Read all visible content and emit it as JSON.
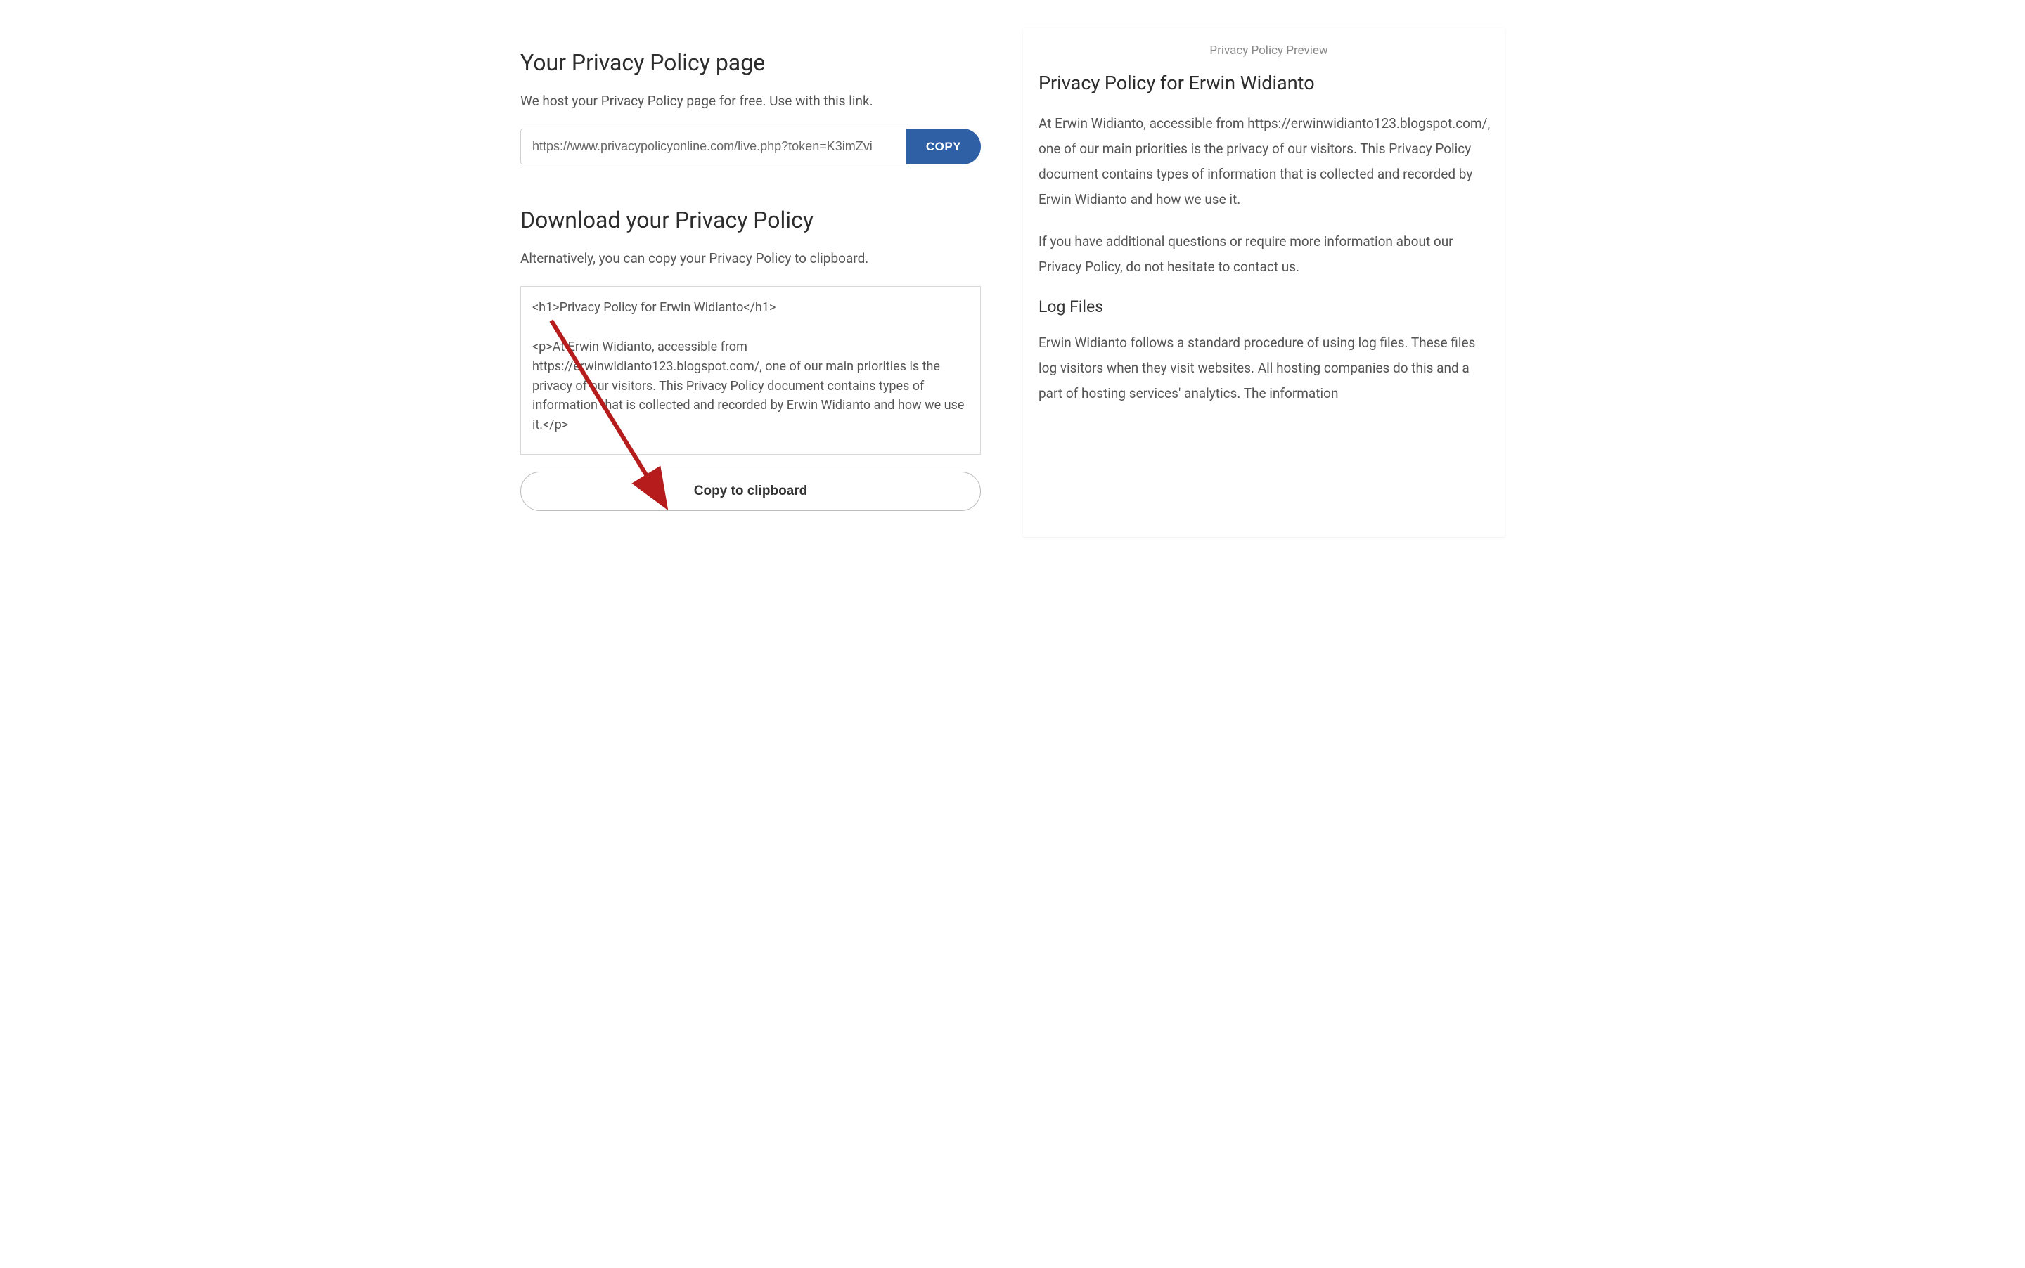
{
  "left": {
    "section1": {
      "title": "Your Privacy Policy page",
      "subtitle": "We host your Privacy Policy page for free. Use with this link.",
      "url": "https://www.privacypolicyonline.com/live.php?token=K3imZvi",
      "copy_label": "COPY"
    },
    "section2": {
      "title": "Download your Privacy Policy",
      "subtitle": "Alternatively, you can copy your Privacy Policy to clipboard.",
      "html_content": "<h1>Privacy Policy for Erwin Widianto</h1>\n\n<p>At Erwin Widianto, accessible from https://erwinwidianto123.blogspot.com/, one of our main priorities is the privacy of our visitors. This Privacy Policy document contains types of information that is collected and recorded by Erwin Widianto and how we use it.</p>\n\n<p>If you have additional questions or require more information about",
      "copy_clipboard_label": "Copy to clipboard"
    }
  },
  "right": {
    "preview_label": "Privacy Policy Preview",
    "h1": "Privacy Policy for Erwin Widianto",
    "p1": "At Erwin Widianto, accessible from https://erwinwidianto123.blogspot.com/, one of our main priorities is the privacy of our visitors. This Privacy Policy document contains types of information that is collected and recorded by Erwin Widianto and how we use it.",
    "p2": "If you have additional questions or require more information about our Privacy Policy, do not hesitate to contact us.",
    "h2": "Log Files",
    "p3": "Erwin Widianto follows a standard procedure of using log files. These files log visitors when they visit websites. All hosting companies do this and a part of hosting services' analytics. The information"
  }
}
